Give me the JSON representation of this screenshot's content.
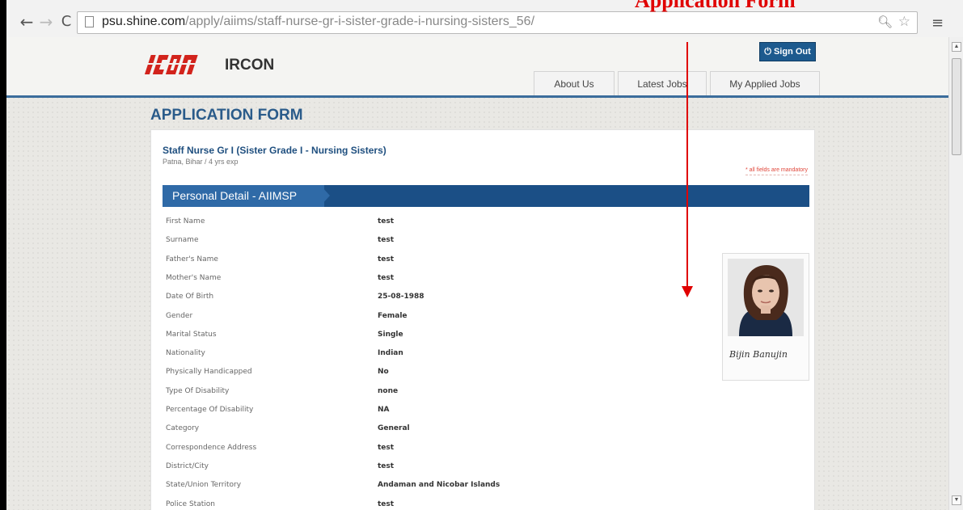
{
  "annotation": {
    "title": "Application Form"
  },
  "browser": {
    "url_host": "psu.shine.com",
    "url_path": "/apply/aiims/staff-nurse-gr-i-sister-grade-i-nursing-sisters_56/",
    "icons": {
      "back": "arrow-left-icon",
      "forward": "arrow-right-icon",
      "reload": "reload-icon",
      "zoom": "magnifier-icon",
      "bookmark": "star-icon",
      "menu": "hamburger-menu-icon"
    }
  },
  "site": {
    "logo_text": "IRCON",
    "logo_mark": "Ircon",
    "sign_out": "⏻ Sign Out",
    "nav": [
      "About Us",
      "Latest Jobs",
      "My Applied Jobs"
    ]
  },
  "form": {
    "title": "APPLICATION FORM",
    "job_title": "Staff Nurse Gr I (Sister Grade I - Nursing Sisters)",
    "job_meta": "Patna, Bihar / 4 yrs exp",
    "mandatory_note": "* all fields are mandatory",
    "section_title": "Personal Detail - AIIMSP",
    "signature": "Bijin Banujin",
    "fields": [
      {
        "label": "First Name",
        "value": "test"
      },
      {
        "label": "Surname",
        "value": "test"
      },
      {
        "label": "Father's Name",
        "value": "test"
      },
      {
        "label": "Mother's Name",
        "value": "test"
      },
      {
        "label": "Date Of Birth",
        "value": "25-08-1988"
      },
      {
        "label": "Gender",
        "value": "Female"
      },
      {
        "label": "Marital Status",
        "value": "Single"
      },
      {
        "label": "Nationality",
        "value": "Indian"
      },
      {
        "label": "Physically Handicapped",
        "value": "No"
      },
      {
        "label": "Type Of Disability",
        "value": "none"
      },
      {
        "label": "Percentage Of Disability",
        "value": "NA"
      },
      {
        "label": "Category",
        "value": "General"
      },
      {
        "label": "Correspondence Address",
        "value": "test"
      },
      {
        "label": "District/City",
        "value": "test"
      },
      {
        "label": "State/Union Territory",
        "value": "Andaman and Nicobar Islands"
      },
      {
        "label": "Police Station",
        "value": "test"
      }
    ]
  },
  "colors": {
    "accent": "#1d5a8e",
    "annotation": "#e00000",
    "logo": "#d2231c"
  }
}
